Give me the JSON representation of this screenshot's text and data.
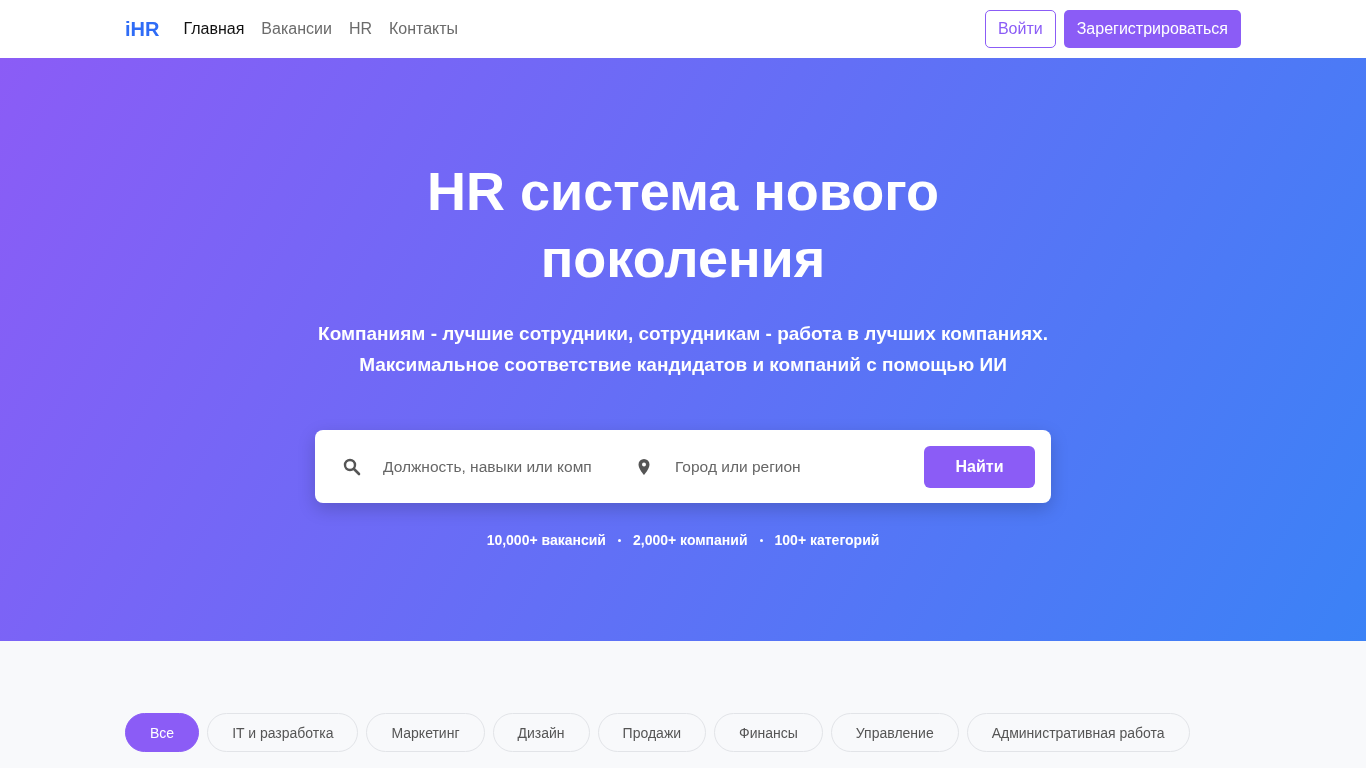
{
  "navbar": {
    "logo": "iHR",
    "links": [
      {
        "label": "Главная",
        "selected": true
      },
      {
        "label": "Вакансии",
        "selected": false
      },
      {
        "label": "HR",
        "selected": false
      },
      {
        "label": "Контакты",
        "selected": false
      }
    ],
    "login": "Войти",
    "register": "Зарегистрироваться"
  },
  "hero": {
    "title_lines": [
      "HR система нового",
      "поколения"
    ],
    "subtitle_lines": [
      "Компаниям - лучшие сотрудники, сотрудникам - работа в лучших компаниях.",
      "Максимальное соответствие кандидатов и компаний с помощью ИИ"
    ],
    "search": {
      "query_placeholder": "Должность, навыки или комп",
      "location_placeholder": "Город или регион",
      "button": "Найти"
    },
    "stats": [
      "10,000+ вакансий",
      "2,000+ компаний",
      "100+ категорий"
    ]
  },
  "categories": [
    {
      "label": "Все",
      "selected": true
    },
    {
      "label": "IT и разработка",
      "selected": false
    },
    {
      "label": "Маркетинг",
      "selected": false
    },
    {
      "label": "Дизайн",
      "selected": false
    },
    {
      "label": "Продажи",
      "selected": false
    },
    {
      "label": "Финансы",
      "selected": false
    },
    {
      "label": "Управление",
      "selected": false
    },
    {
      "label": "Административная работа",
      "selected": false
    }
  ]
}
